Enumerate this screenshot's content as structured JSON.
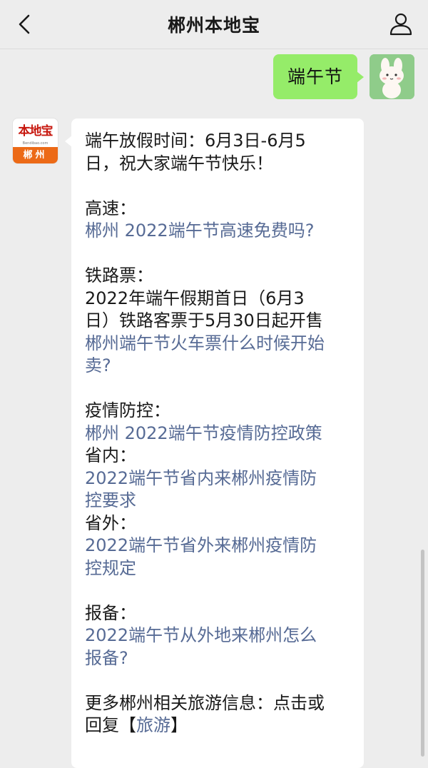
{
  "header": {
    "title": "郴州本地宝",
    "back_icon": "chevron-left-icon",
    "profile_icon": "person-icon"
  },
  "outgoing": {
    "text": "端午节"
  },
  "bot": {
    "avatar_logo": "本地宝",
    "avatar_url": "Bendibao.com",
    "avatar_city": "郴州"
  },
  "message": {
    "intro_1": "端午放假时间：6月3日-6月5",
    "intro_2": "日，祝大家端午节快乐！",
    "highway_label": "高速：",
    "highway_link": "郴州 2022端午节高速免费吗?",
    "rail_label": "铁路票：",
    "rail_text_1": "2022年端午假期首日（6月3",
    "rail_text_2": "日）铁路客票于5月30日起开售",
    "rail_link_1": "郴州端午节火车票什么时候开始",
    "rail_link_2": "卖?",
    "epidemic_label": "疫情防控：",
    "epidemic_link": "郴州 2022端午节疫情防控政策",
    "in_province_label": "省内：",
    "in_province_link_1": "2022端午节省内来郴州疫情防",
    "in_province_link_2": "控要求",
    "out_province_label": "省外：",
    "out_province_link_1": "2022端午节省外来郴州疫情防",
    "out_province_link_2": "控规定",
    "report_label": "报备：",
    "report_link_1": "2022端午节从外地来郴州怎么",
    "report_link_2": "报备?",
    "more_1": "更多郴州相关旅游信息：点击或",
    "more_2_prefix": "回复【",
    "more_2_link": "旅游",
    "more_2_suffix": "】"
  },
  "colors": {
    "background": "#ededed",
    "outgoing_bubble": "#95ec69",
    "incoming_bubble": "#ffffff",
    "link": "#576b95",
    "brand_orange": "#ec6a17",
    "brand_red": "#c7170e"
  }
}
